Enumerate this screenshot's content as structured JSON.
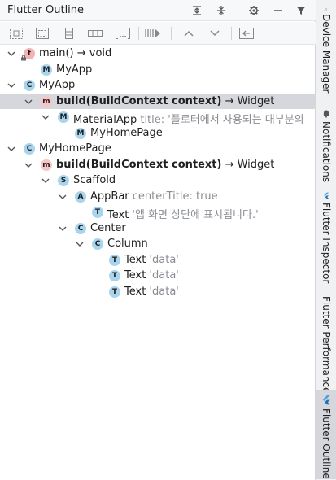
{
  "header": {
    "title": "Flutter Outline"
  },
  "tree": [
    {
      "level": 0,
      "expanded": true,
      "badge": "f",
      "badge_style": "red",
      "name": "main() → void",
      "bold": false,
      "attr": "",
      "lock": true
    },
    {
      "level": 1,
      "expanded": null,
      "badge": "M",
      "badge_style": "blue",
      "name": "MyApp",
      "bold": false,
      "attr": ""
    },
    {
      "level": 0,
      "expanded": true,
      "badge": "C",
      "badge_style": "blue",
      "name": "MyApp",
      "bold": false,
      "attr": ""
    },
    {
      "level": 1,
      "expanded": true,
      "badge": "m",
      "badge_style": "pink",
      "name": "build(BuildContext context)",
      "suffix": " → Widget",
      "bold": true,
      "attr": "",
      "selected": true
    },
    {
      "level": 2,
      "expanded": true,
      "badge": "M",
      "badge_style": "blue",
      "name": "MaterialApp",
      "bold": false,
      "attr": "title: '플로터에서 사용되는 대부분의"
    },
    {
      "level": 3,
      "expanded": null,
      "badge": "M",
      "badge_style": "blue",
      "name": "MyHomePage",
      "bold": false,
      "attr": ""
    },
    {
      "level": 0,
      "expanded": true,
      "badge": "C",
      "badge_style": "blue",
      "name": "MyHomePage",
      "bold": false,
      "attr": ""
    },
    {
      "level": 1,
      "expanded": true,
      "badge": "m",
      "badge_style": "pink",
      "name": "build(BuildContext context)",
      "suffix": " → Widget",
      "bold": true,
      "attr": ""
    },
    {
      "level": 2,
      "expanded": true,
      "badge": "S",
      "badge_style": "blue",
      "name": "Scaffold",
      "bold": false,
      "attr": ""
    },
    {
      "level": 3,
      "expanded": true,
      "badge": "A",
      "badge_style": "blue",
      "name": "AppBar",
      "bold": false,
      "attr": "centerTitle: true"
    },
    {
      "level": 4,
      "expanded": null,
      "badge": "T",
      "badge_style": "blue",
      "name": "Text",
      "bold": false,
      "attr": "'앱 화면 상단에 표시됩니다.'"
    },
    {
      "level": 3,
      "expanded": true,
      "badge": "C",
      "badge_style": "blue",
      "name": "Center",
      "bold": false,
      "attr": ""
    },
    {
      "level": 4,
      "expanded": true,
      "badge": "C",
      "badge_style": "blue",
      "name": "Column",
      "bold": false,
      "attr": ""
    },
    {
      "level": 5,
      "expanded": null,
      "badge": "T",
      "badge_style": "blue",
      "name": "Text",
      "bold": false,
      "attr": "'data'"
    },
    {
      "level": 5,
      "expanded": null,
      "badge": "T",
      "badge_style": "blue",
      "name": "Text",
      "bold": false,
      "attr": "'data'"
    },
    {
      "level": 5,
      "expanded": null,
      "badge": "T",
      "badge_style": "blue",
      "name": "Text",
      "bold": false,
      "attr": "'data'"
    }
  ],
  "right_tabs": [
    {
      "label": "Device Manager",
      "icon": "device-icon",
      "active": false
    },
    {
      "label": "Notifications",
      "icon": "bell-icon",
      "active": false
    },
    {
      "label": "Flutter Inspector",
      "icon": "flutter-icon",
      "active": false
    },
    {
      "label": "Flutter Performance",
      "icon": "flutter-icon",
      "active": false
    },
    {
      "label": "Flutter Outline",
      "icon": "flutter-icon",
      "active": true
    }
  ],
  "colors": {
    "selected_row": "#d5d7dc",
    "badge_blue": "#a9d4ee",
    "badge_red": "#f4b2b2",
    "attr_gray": "#8a8d93"
  }
}
